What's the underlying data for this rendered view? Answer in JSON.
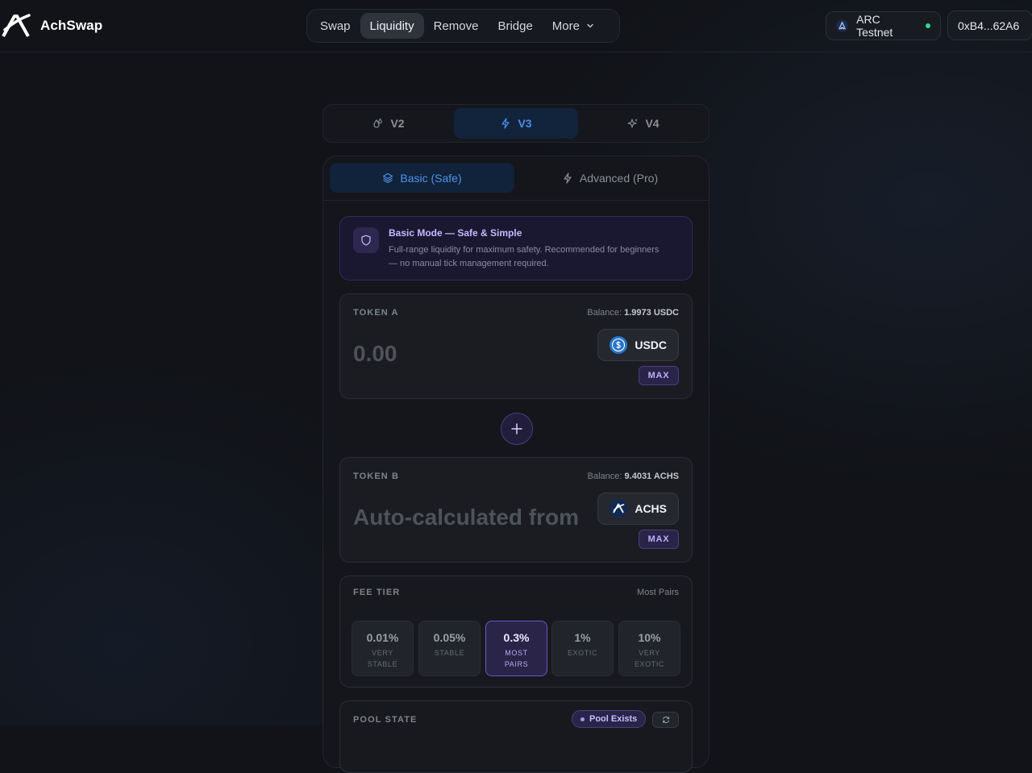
{
  "header": {
    "brand_name": "AchSwap",
    "nav": [
      {
        "label": "Swap",
        "active": false
      },
      {
        "label": "Liquidity",
        "active": true
      },
      {
        "label": "Remove",
        "active": false
      },
      {
        "label": "Bridge",
        "active": false
      },
      {
        "label": "More",
        "active": false,
        "has_dropdown": true
      }
    ],
    "network": {
      "label": "ARC Testnet",
      "status_color": "#2fd98a"
    },
    "wallet": {
      "address": "0xB4...62A6"
    }
  },
  "version_tabs": [
    {
      "label": "V2",
      "icon": "droplets-icon",
      "active": false
    },
    {
      "label": "V3",
      "icon": "bolt-icon",
      "active": true
    },
    {
      "label": "V4",
      "icon": "sparkles-icon",
      "active": false
    }
  ],
  "mode_tabs": [
    {
      "label": "Basic (Safe)",
      "icon": "layers-icon",
      "active": true
    },
    {
      "label": "Advanced (Pro)",
      "icon": "bolt-icon",
      "active": false
    }
  ],
  "notice": {
    "icon": "shield-icon",
    "title": "Basic Mode — Safe & Simple",
    "body": "Full-range liquidity for maximum safety. Recommended for beginners — no manual tick management required."
  },
  "token_a": {
    "label": "TOKEN A",
    "balance_label": "Balance:",
    "balance_value": "1.9973 USDC",
    "amount_placeholder": "0.00",
    "token_symbol": "USDC",
    "token_icon": "usdc-icon",
    "max_label": "MAX"
  },
  "plus_icon": "plus-icon",
  "token_b": {
    "label": "TOKEN B",
    "balance_label": "Balance:",
    "balance_value": "9.4031 ACHS",
    "amount_placeholder": "Auto-calculated from",
    "token_symbol": "ACHS",
    "token_icon": "achs-icon",
    "max_label": "MAX"
  },
  "fee_tier": {
    "label": "FEE TIER",
    "selected_label": "Most Pairs",
    "options": [
      {
        "value": "0.01%",
        "desc": "VERY STABLE",
        "active": false
      },
      {
        "value": "0.05%",
        "desc": "STABLE",
        "active": false
      },
      {
        "value": "0.3%",
        "desc": "MOST PAIRS",
        "active": true
      },
      {
        "value": "1%",
        "desc": "EXOTIC",
        "active": false
      },
      {
        "value": "10%",
        "desc": "VERY EXOTIC",
        "active": false
      }
    ]
  },
  "pool_state": {
    "label": "POOL STATE",
    "badge": "Pool Exists",
    "refresh_icon": "refresh-icon"
  },
  "colors": {
    "accent_blue": "#4a8fe8",
    "accent_purple": "#a892ff",
    "background": "#111318"
  }
}
